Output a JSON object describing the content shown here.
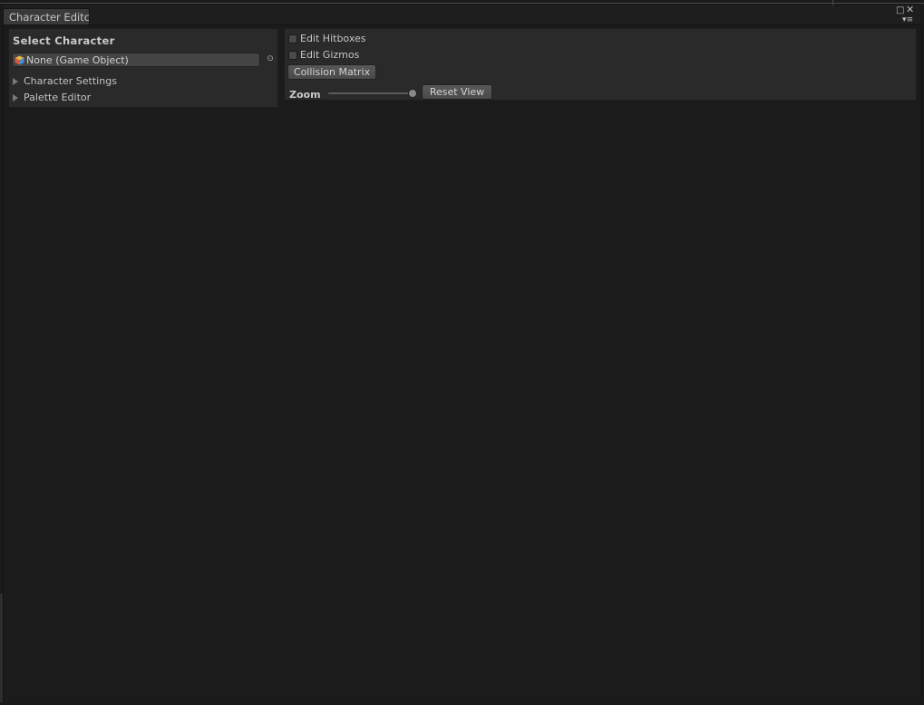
{
  "window": {
    "tab_title": "Character Editc",
    "maximize_icon": "maximize-icon",
    "close_icon": "close-icon",
    "menu_icon": "context-menu-icon"
  },
  "left_panel": {
    "title": "Select Character",
    "object_field": {
      "value": "None (Game Object)",
      "icon": "game-object-icon"
    },
    "picker_icon": "object-picker-icon",
    "foldouts": [
      {
        "label": "Character Settings",
        "expanded": false
      },
      {
        "label": "Palette Editor",
        "expanded": false
      }
    ]
  },
  "right_panel": {
    "checkboxes": [
      {
        "label": "Edit Hitboxes",
        "checked": false
      },
      {
        "label": "Edit Gizmos",
        "checked": false
      }
    ],
    "collision_matrix_label": "Collision Matrix",
    "zoom": {
      "label": "Zoom",
      "value_fraction": 0.97
    },
    "reset_view_label": "Reset View"
  },
  "colors": {
    "background": "#1b1b1b",
    "panel": "#2a2a2a",
    "button": "#505050",
    "text": "#c4c4c4"
  }
}
